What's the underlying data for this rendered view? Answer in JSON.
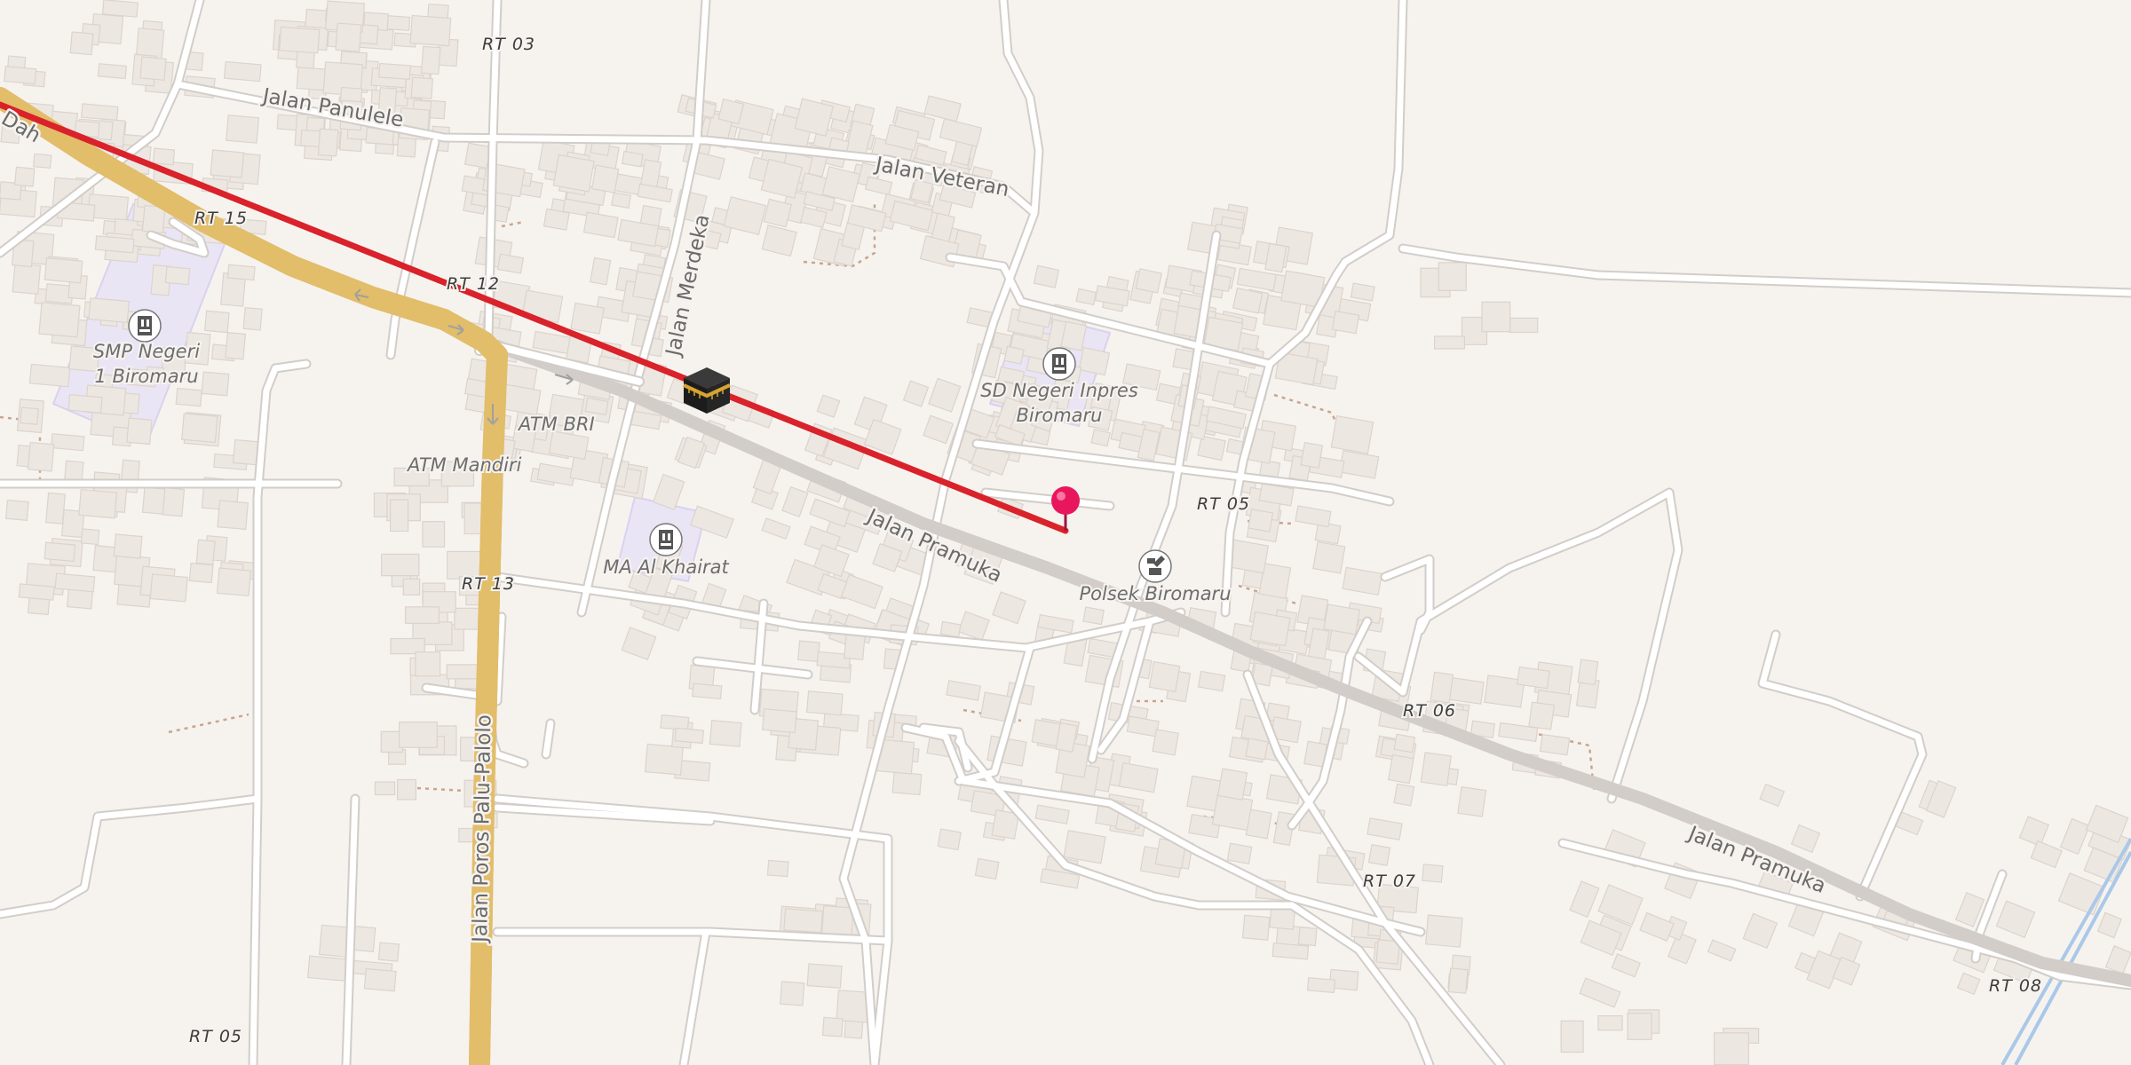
{
  "map": {
    "roads": {
      "panulele": "Jalan Panulele",
      "veteran": "Jalan Veteran",
      "merdeka": "Jalan Merdeka",
      "pramuka_a": "Jalan Pramuka",
      "pramuka_b": "Jalan Pramuka",
      "poros": "Jalan Poros Palu-Palolo",
      "dah": "Dah"
    },
    "rt_labels": {
      "rt03": "RT 03",
      "rt15": "RT 15",
      "rt12": "RT 12",
      "rt13": "RT 13",
      "rt05a": "RT 05",
      "rt05b": "RT 05",
      "rt06": "RT 06",
      "rt07": "RT 07",
      "rt08": "RT 08"
    },
    "pois": {
      "smp": {
        "line1": "SMP Negeri",
        "line2": "1 Biromaru",
        "icon": "school-icon"
      },
      "sd": {
        "line1": "SD Negeri Inpres",
        "line2": "Biromaru",
        "icon": "school-icon"
      },
      "ma": {
        "name": "MA Al Khairat",
        "icon": "school-icon"
      },
      "polsek": {
        "name": "Polsek Biromaru",
        "icon": "police-icon"
      },
      "atm_bri": {
        "name": "ATM BRI"
      },
      "atm_mandiri": {
        "name": "ATM Mandiri"
      }
    },
    "markers": {
      "kaaba": {
        "icon": "kaaba-icon"
      },
      "pin": {
        "icon": "location-pin-icon",
        "color": "#e8175d"
      }
    },
    "qibla_line": {
      "color": "#d9222a"
    },
    "colors": {
      "background": "#f6f3ef",
      "road": "#ffffff",
      "road_casing": "#d2cdc8",
      "main_road": "#f9d98e",
      "main_road_casing": "#e2bd6a",
      "school_area": "#e9e5f5",
      "building": "#ede7e2",
      "waterway": "#aac8e8"
    }
  }
}
